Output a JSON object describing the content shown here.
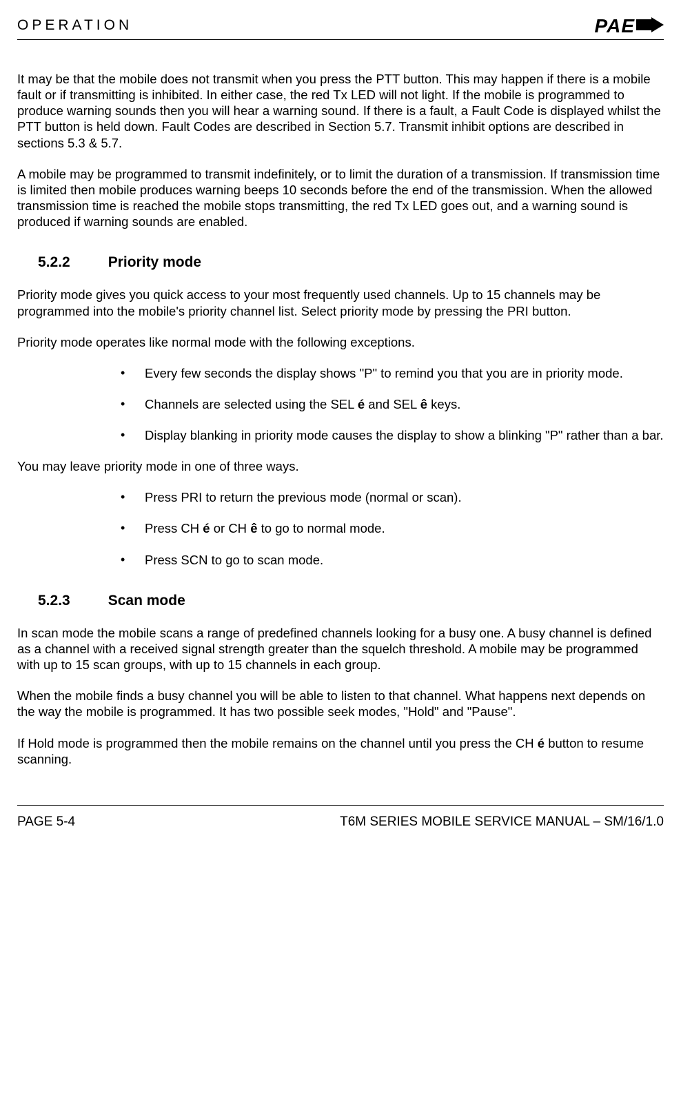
{
  "header": {
    "title": "OPERATION",
    "logo_text": "PAE"
  },
  "body": {
    "p1": "It may be that the mobile does not transmit when you press the PTT button.  This may happen if there is a mobile fault or if transmitting is inhibited.  In either case, the red Tx LED will not light.  If the mobile is programmed to produce warning sounds then you will hear a warning sound.  If there is a fault, a Fault Code is displayed whilst the PTT button is held down.  Fault Codes are described in Section 5.7.  Transmit inhibit options are described in sections 5.3 & 5.7.",
    "p2": "A mobile may be programmed to transmit indefinitely, or to limit the duration of a transmission.  If transmission time is limited then mobile produces warning beeps 10 seconds before the end of the transmission.  When the allowed transmission time is reached the mobile stops transmitting, the red Tx LED goes out, and a warning sound is produced if warning sounds are enabled.",
    "s522": {
      "num": "5.2.2",
      "title": "Priority mode",
      "p1": "Priority mode gives you quick access to your most frequently used channels.  Up to 15 channels may be programmed into the mobile's priority channel list.  Select priority mode by pressing the PRI button.",
      "p2": "Priority mode operates like normal mode with the following exceptions.",
      "list1": {
        "i1": "Every few seconds the display shows \"P\" to remind you that you are in priority mode.",
        "i2_a": "Channels are selected using the SEL ",
        "i2_b": " and SEL ",
        "i2_c": " keys.",
        "i3": "Display blanking in priority mode causes the display to show a blinking \"P\" rather than a bar."
      },
      "p3": "You may leave priority mode in one of three ways.",
      "list2": {
        "i1": "Press PRI to return the previous mode (normal or scan).",
        "i2_a": "Press CH ",
        "i2_b": " or CH ",
        "i2_c": " to go to normal mode.",
        "i3": "Press SCN to go to scan mode."
      }
    },
    "s523": {
      "num": "5.2.3",
      "title": "Scan mode",
      "p1": "In scan mode the mobile scans a range of predefined channels looking for a busy one.  A busy channel is defined as a channel with a received signal strength greater than the squelch threshold.  A mobile may be programmed with up to 15 scan groups, with up to 15 channels in each group.",
      "p2": "When the mobile finds a busy channel you will be able to listen to that channel.  What happens next depends on the way the mobile is programmed.  It has two possible seek modes, \"Hold\" and \"Pause\".",
      "p3_a": "If Hold mode is programmed then the mobile remains on the channel until you press the CH ",
      "p3_b": " button to resume scanning."
    }
  },
  "footer": {
    "left": "PAGE 5-4",
    "right": "T6M SERIES MOBILE SERVICE MANUAL – SM/16/1.0"
  },
  "icons": {
    "up": "é",
    "down": "ê"
  }
}
